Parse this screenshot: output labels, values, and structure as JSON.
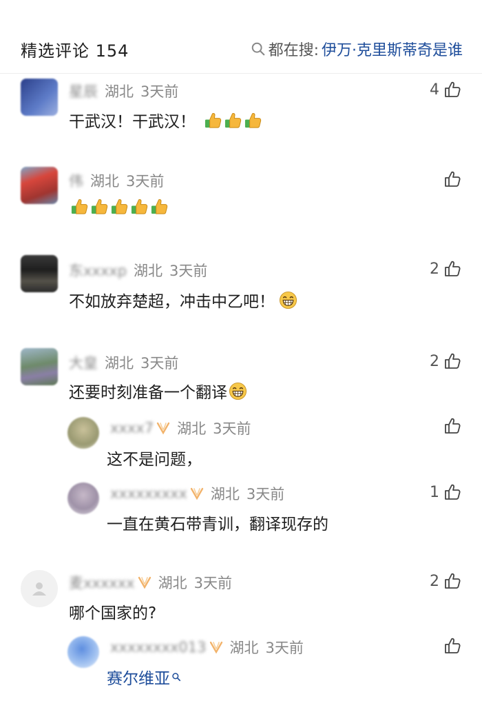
{
  "header": {
    "title": "精选评论 154",
    "search_label": "都在搜:",
    "search_query": "伊万·克里斯蒂奇是谁"
  },
  "comments": [
    {
      "name": "星辰",
      "location": "湖北",
      "time": "3天前",
      "likes": "4",
      "text": "干武汉！干武汉！",
      "emoji": "thumbs-up x3"
    },
    {
      "name": "伟",
      "location": "湖北",
      "time": "3天前",
      "likes": "",
      "text": "",
      "emoji": "thumbs-up x5"
    },
    {
      "name": "东xxxxp",
      "location": "湖北",
      "time": "3天前",
      "likes": "2",
      "text": "不如放弃楚超，冲击中乙吧！",
      "emoji": "grin"
    },
    {
      "name": "大皇",
      "location": "湖北",
      "time": "3天前",
      "likes": "2",
      "text": "还要时刻准备一个翻译",
      "emoji": "grin",
      "replies": [
        {
          "name": "xxxx7",
          "location": "湖北",
          "time": "3天前",
          "likes": "",
          "text": "这不是问题，"
        },
        {
          "name": "xxxxxxxxx",
          "location": "湖北",
          "time": "3天前",
          "likes": "1",
          "text": "一直在黄石带青训，翻译现存的"
        }
      ]
    },
    {
      "name": "麦xxxxxx",
      "location": "湖北",
      "time": "3天前",
      "likes": "2",
      "text": "哪个国家的?",
      "replies": [
        {
          "name": "xxxxxxxx013",
          "location": "湖北",
          "time": "3天前",
          "likes": "",
          "text": "赛尔维亚"
        }
      ]
    }
  ],
  "colors": {
    "link": "#1f4e9b",
    "meta": "#888888",
    "text": "#1e1e1e"
  }
}
